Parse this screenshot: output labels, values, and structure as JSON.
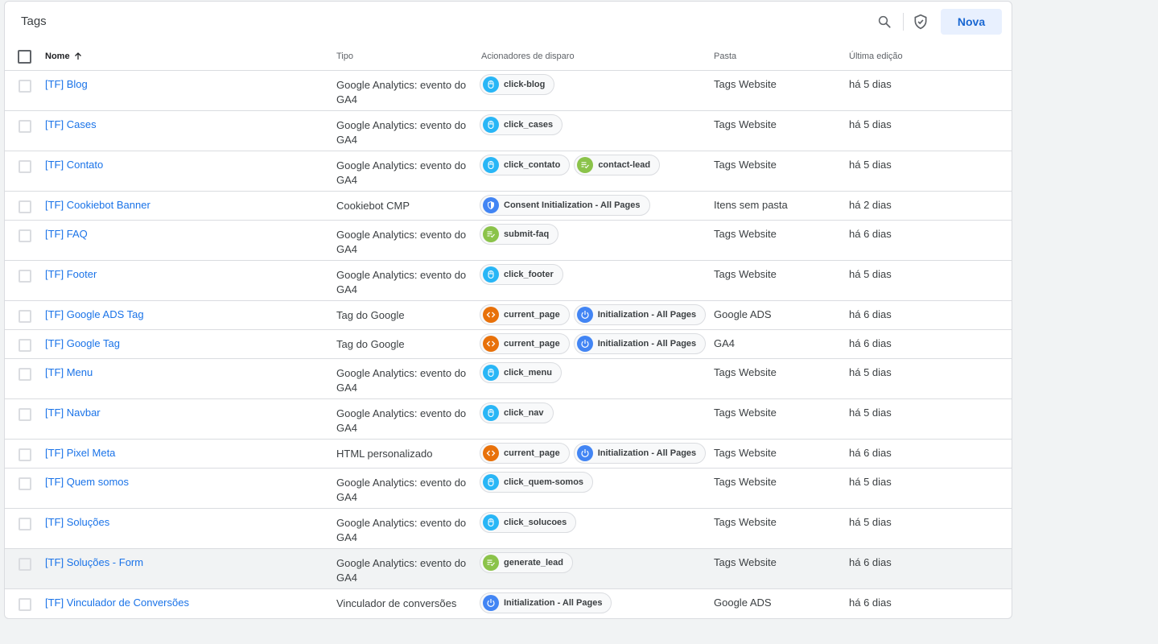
{
  "header": {
    "title": "Tags",
    "new_button": "Nova",
    "search_icon": "search-icon",
    "shield_icon": "shield-check-icon"
  },
  "colors": {
    "link": "#1a73e8",
    "click_trigger": "#29b6f6",
    "custom_event_trigger": "#8bc34a",
    "page_view_trigger": "#e8710a",
    "init_trigger": "#4285f4",
    "consent_trigger": "#4285f4",
    "new_button_bg": "#e8f0fe"
  },
  "columns": {
    "name": "Nome",
    "type": "Tipo",
    "triggers": "Acionadores de disparo",
    "folder": "Pasta",
    "last_edited": "Última edição"
  },
  "rows": [
    {
      "name": "[TF] Blog",
      "type": "Google Analytics: evento do GA4",
      "triggers": [
        {
          "label": "click-blog",
          "icon": "click"
        }
      ],
      "folder": "Tags Website",
      "edited": "há 5 dias"
    },
    {
      "name": "[TF] Cases",
      "type": "Google Analytics: evento do GA4",
      "triggers": [
        {
          "label": "click_cases",
          "icon": "click"
        }
      ],
      "folder": "Tags Website",
      "edited": "há 5 dias"
    },
    {
      "name": "[TF] Contato",
      "type": "Google Analytics: evento do GA4",
      "triggers": [
        {
          "label": "click_contato",
          "icon": "click"
        },
        {
          "label": "contact-lead",
          "icon": "custom"
        }
      ],
      "folder": "Tags Website",
      "edited": "há 5 dias"
    },
    {
      "name": "[TF] Cookiebot Banner",
      "type": "Cookiebot CMP",
      "triggers": [
        {
          "label": "Consent Initialization - All Pages",
          "icon": "consent"
        }
      ],
      "folder": "Itens sem pasta",
      "edited": "há 2 dias"
    },
    {
      "name": "[TF] FAQ",
      "type": "Google Analytics: evento do GA4",
      "triggers": [
        {
          "label": "submit-faq",
          "icon": "custom"
        }
      ],
      "folder": "Tags Website",
      "edited": "há 6 dias"
    },
    {
      "name": "[TF] Footer",
      "type": "Google Analytics: evento do GA4",
      "triggers": [
        {
          "label": "click_footer",
          "icon": "click"
        }
      ],
      "folder": "Tags Website",
      "edited": "há 5 dias"
    },
    {
      "name": "[TF] Google ADS Tag",
      "type": "Tag do Google",
      "triggers": [
        {
          "label": "current_page",
          "icon": "pageview"
        },
        {
          "label": "Initialization - All Pages",
          "icon": "init"
        }
      ],
      "folder": "Google ADS",
      "edited": "há 6 dias"
    },
    {
      "name": "[TF] Google Tag",
      "type": "Tag do Google",
      "triggers": [
        {
          "label": "current_page",
          "icon": "pageview"
        },
        {
          "label": "Initialization - All Pages",
          "icon": "init"
        }
      ],
      "folder": "GA4",
      "edited": "há 6 dias"
    },
    {
      "name": "[TF] Menu",
      "type": "Google Analytics: evento do GA4",
      "triggers": [
        {
          "label": "click_menu",
          "icon": "click"
        }
      ],
      "folder": "Tags Website",
      "edited": "há 5 dias"
    },
    {
      "name": "[TF] Navbar",
      "type": "Google Analytics: evento do GA4",
      "triggers": [
        {
          "label": "click_nav",
          "icon": "click"
        }
      ],
      "folder": "Tags Website",
      "edited": "há 5 dias"
    },
    {
      "name": "[TF] Pixel Meta",
      "type": "HTML personalizado",
      "triggers": [
        {
          "label": "current_page",
          "icon": "pageview"
        },
        {
          "label": "Initialization - All Pages",
          "icon": "init"
        }
      ],
      "folder": "Tags Website",
      "edited": "há 6 dias"
    },
    {
      "name": "[TF] Quem somos",
      "type": "Google Analytics: evento do GA4",
      "triggers": [
        {
          "label": "click_quem-somos",
          "icon": "click"
        }
      ],
      "folder": "Tags Website",
      "edited": "há 5 dias"
    },
    {
      "name": "[TF] Soluções",
      "type": "Google Analytics: evento do GA4",
      "triggers": [
        {
          "label": "click_solucoes",
          "icon": "click"
        }
      ],
      "folder": "Tags Website",
      "edited": "há 5 dias"
    },
    {
      "name": "[TF] Soluções - Form",
      "type": "Google Analytics: evento do GA4",
      "triggers": [
        {
          "label": "generate_lead",
          "icon": "custom"
        }
      ],
      "folder": "Tags Website",
      "edited": "há 6 dias",
      "highlighted": true
    },
    {
      "name": "[TF] Vinculador de Conversões",
      "type": "Vinculador de conversões",
      "triggers": [
        {
          "label": "Initialization - All Pages",
          "icon": "init"
        }
      ],
      "folder": "Google ADS",
      "edited": "há 6 dias"
    }
  ]
}
